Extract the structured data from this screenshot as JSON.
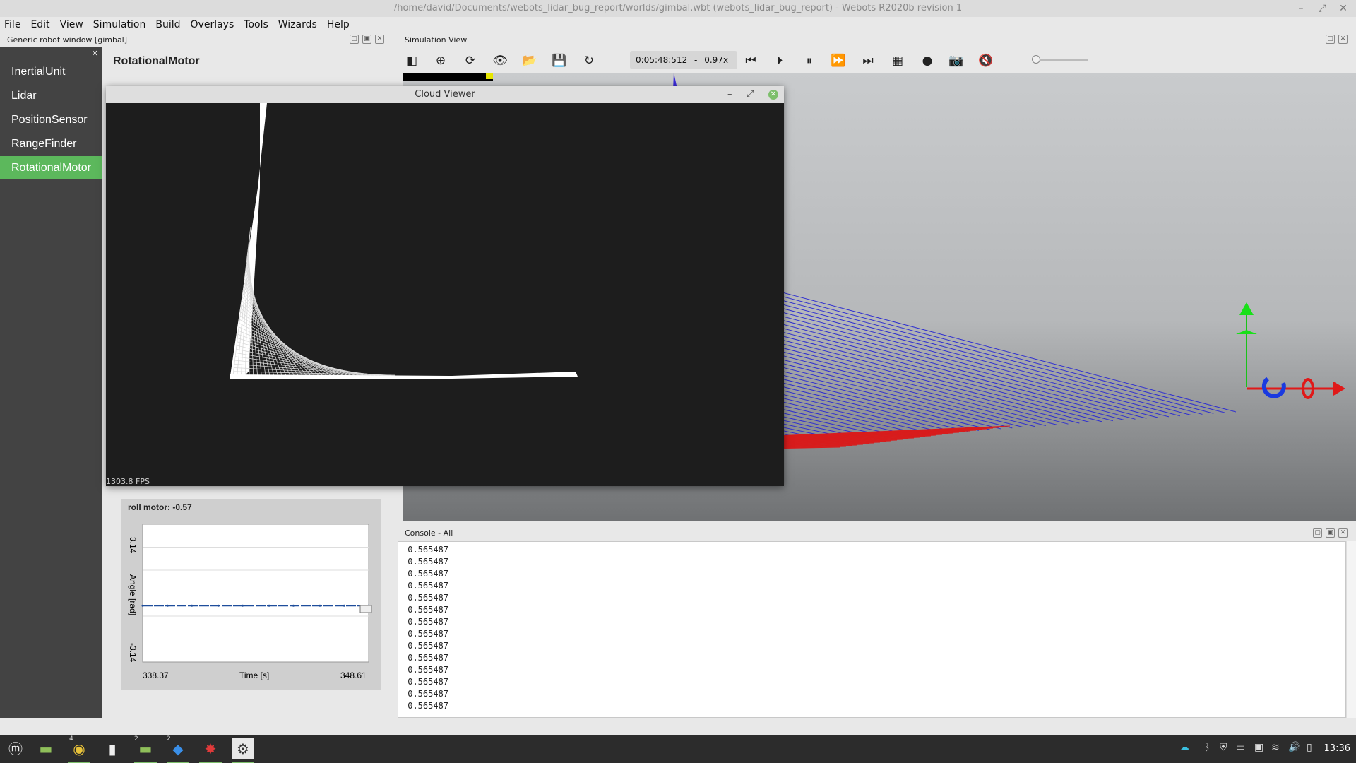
{
  "window": {
    "title": "/home/david/Documents/webots_lidar_bug_report/worlds/gimbal.wbt (webots_lidar_bug_report) - Webots R2020b revision 1"
  },
  "menu": [
    "File",
    "Edit",
    "View",
    "Simulation",
    "Build",
    "Overlays",
    "Tools",
    "Wizards",
    "Help"
  ],
  "robot_window": {
    "header": "Generic robot window [gimbal]",
    "devices": [
      "InertialUnit",
      "Lidar",
      "PositionSensor",
      "RangeFinder",
      "RotationalMotor"
    ],
    "active_device": "RotationalMotor",
    "device_title": "RotationalMotor",
    "plot": {
      "title": "roll motor: -0.57"
    }
  },
  "simulation_view": {
    "header": "Simulation View",
    "time": "0:05:48:512",
    "time_sep": "-",
    "speed": "0.97x",
    "volume": 0
  },
  "cloud_viewer": {
    "title": "Cloud Viewer",
    "fps": "1303.8 FPS"
  },
  "console": {
    "header": "Console - All",
    "lines": [
      "-0.565487",
      "-0.565487",
      "-0.565487",
      "-0.565487",
      "-0.565487",
      "-0.565487",
      "-0.565487",
      "-0.565487",
      "-0.565487",
      "-0.565487",
      "-0.565487",
      "-0.565487",
      "-0.565487",
      "-0.565487"
    ]
  },
  "taskbar": {
    "clock": "13:36",
    "badges": [
      "4",
      "2",
      "2"
    ]
  },
  "chart_data": {
    "type": "line",
    "title": "roll motor: -0.57",
    "xlabel": "Time [s]",
    "ylabel": "Angle [rad]",
    "xlim": [
      338.37,
      348.61
    ],
    "ylim": [
      -3.14,
      3.14
    ],
    "x_ticks": [
      "338.37",
      "348.61"
    ],
    "y_ticks": [
      "3.14",
      "-3.14"
    ],
    "series": [
      {
        "x": [
          338.37,
          339.5,
          340.6,
          341.8,
          342.9,
          344.1,
          345.2,
          346.4,
          347.5,
          348.61
        ],
        "y": [
          -0.57,
          -0.57,
          -0.57,
          -0.57,
          -0.57,
          -0.57,
          -0.57,
          -0.57,
          -0.57,
          -0.57
        ]
      }
    ]
  }
}
